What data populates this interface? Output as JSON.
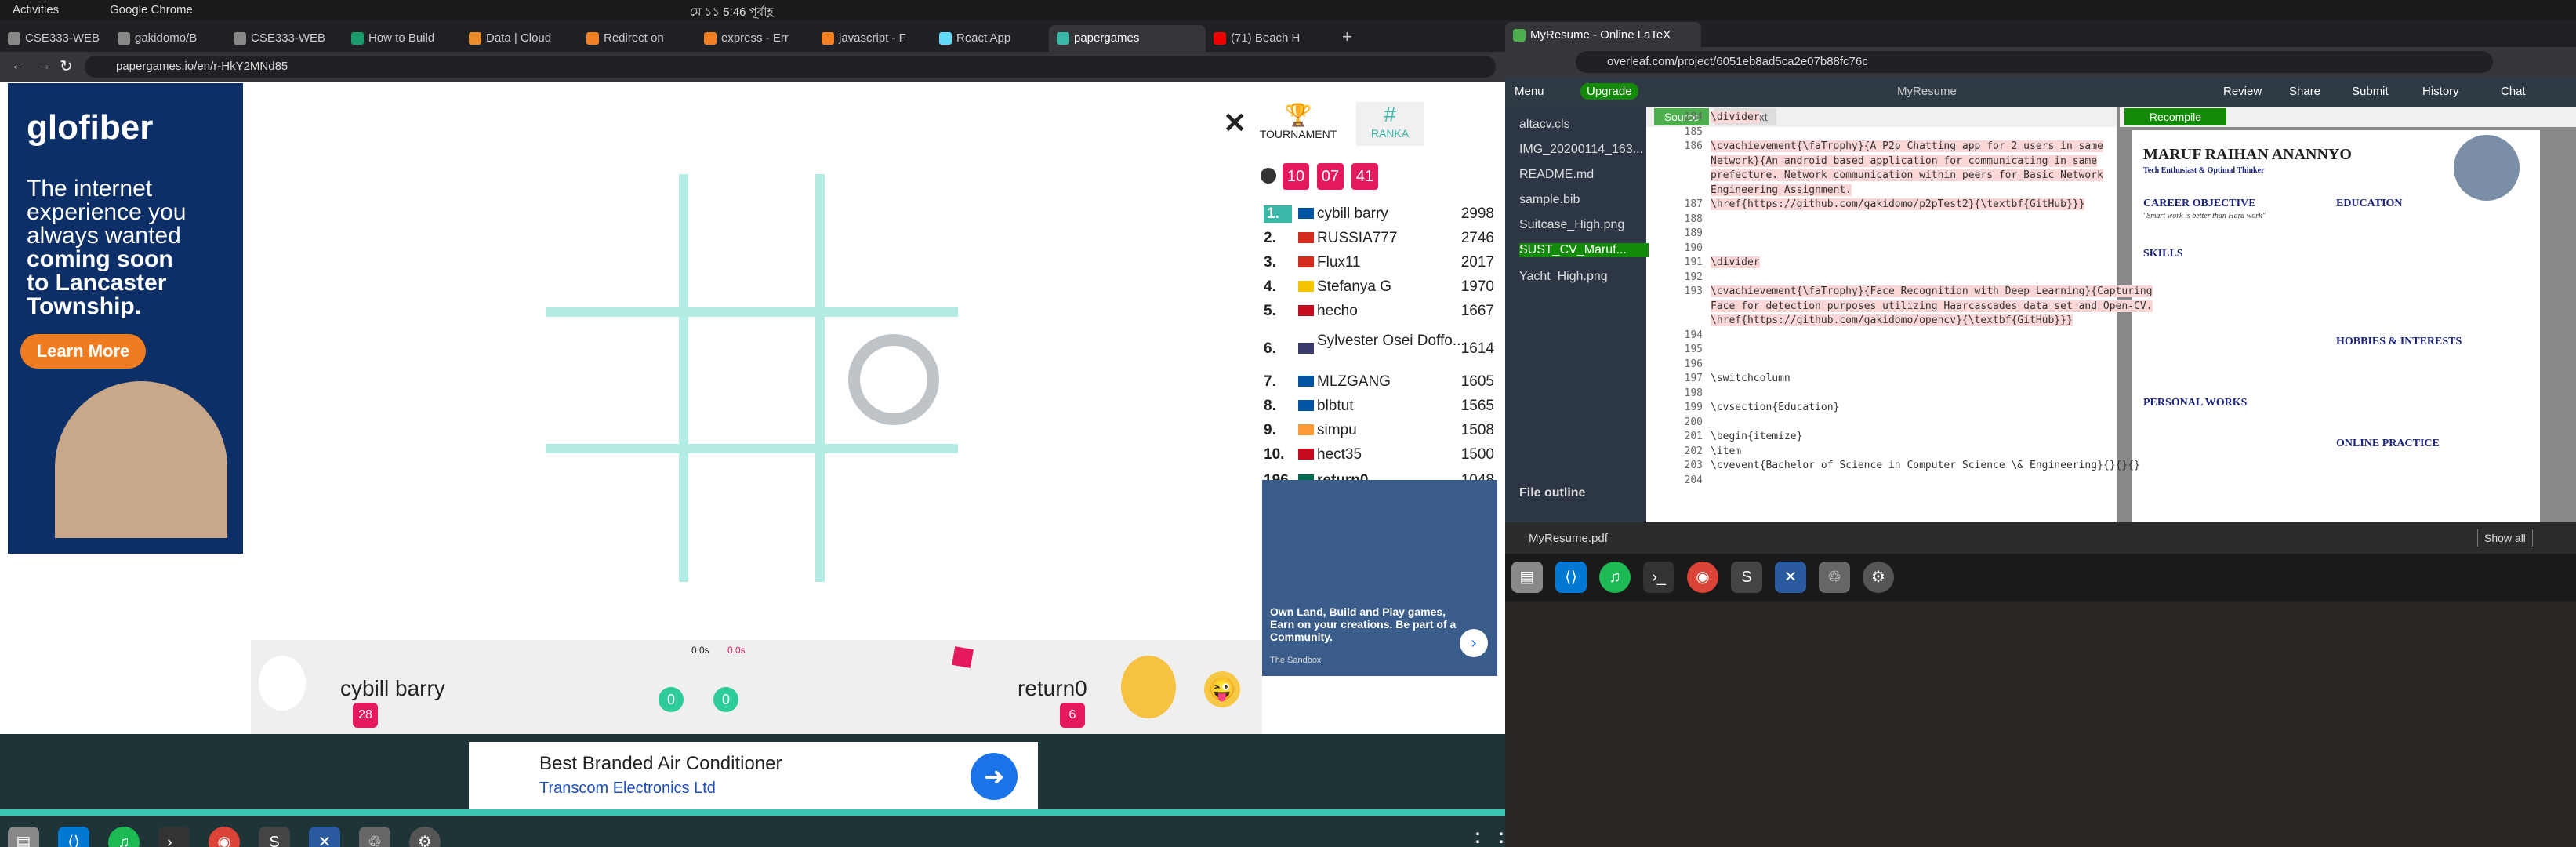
{
  "system": {
    "activities": "Activities",
    "app": "Google Chrome",
    "clock": "মে ১১  5:46 পূর্বাহ্ণ"
  },
  "left": {
    "tabs": [
      "CSE333-WEB",
      "gakidomo/B",
      "CSE333-WEB",
      "How to Build",
      "Data | Cloud",
      "Redirect on",
      "express - Err",
      "javascript - F",
      "React App",
      "papergames",
      "(71) Beach H"
    ],
    "url": "papergames.io/en/r-HkY2MNd85",
    "ad": {
      "brand": "glofiber",
      "line1": "The internet",
      "line2": "experience you",
      "line3": "always wanted",
      "line4": "coming soon",
      "line5": "to Lancaster",
      "line6": "Township.",
      "cta": "Learn More"
    },
    "close": "✕",
    "tournament": "TOURNAMENT",
    "ranka": "RANKA",
    "timer": [
      "10",
      "07",
      "41"
    ],
    "rankings": [
      {
        "pos": "1.",
        "name": "cybill barry",
        "score": "2998",
        "flag": "#0055a4"
      },
      {
        "pos": "2.",
        "name": "RUSSIA777",
        "score": "2746",
        "flag": "#d52b1e"
      },
      {
        "pos": "3.",
        "name": "Flux11",
        "score": "2017",
        "flag": "#d52b1e"
      },
      {
        "pos": "4.",
        "name": "Stefanya G",
        "score": "1970",
        "flag": "#f4c400"
      },
      {
        "pos": "5.",
        "name": "hecho",
        "score": "1667",
        "flag": "#c60b1e"
      },
      {
        "pos": "6.",
        "name": "Sylvester Osei Doffo...",
        "score": "1614",
        "flag": "#3c3b6e"
      },
      {
        "pos": "7.",
        "name": "MLZGANG",
        "score": "1605",
        "flag": "#0055a4"
      },
      {
        "pos": "8.",
        "name": "blbtut",
        "score": "1565",
        "flag": "#0055a4"
      },
      {
        "pos": "9.",
        "name": "simpu",
        "score": "1508",
        "flag": "#ff9933"
      },
      {
        "pos": "10.",
        "name": "hect35",
        "score": "1500",
        "flag": "#c60b1e"
      },
      {
        "pos": "196.",
        "name": "return0",
        "score": "1048",
        "flag": "#006a4e"
      }
    ],
    "game_ad": {
      "text": "Own Land, Build and Play games, Earn on your creations. Be part of a Community.",
      "src": "The Sandbox"
    },
    "player1": {
      "name": "cybill barry",
      "level": "28",
      "score": "0",
      "time": "0.0s"
    },
    "player2": {
      "name": "return0",
      "level": "6",
      "score": "0",
      "time": "0.0s"
    },
    "bottom_ad": {
      "title": "Best Branded Air Conditioner",
      "sub": "Transcom Electronics Ltd"
    }
  },
  "right": {
    "tab": "MyResume - Online LaTeX",
    "url": "overleaf.com/project/6051eb8ad5ca2e07b88fc76c",
    "menu": "Menu",
    "upgrade": "Upgrade",
    "project": "MyResume",
    "actions": [
      "Review",
      "Share",
      "Submit",
      "History",
      "Chat"
    ],
    "source": "Source",
    "rich": "Rich Text",
    "recompile": "Recompile",
    "files": [
      "altacv.cls",
      "IMG_20200114_163...",
      "README.md",
      "sample.bib",
      "Suitcase_High.png",
      "SUST_CV_Maruf...",
      "Yacht_High.png"
    ],
    "outline": "File outline",
    "lines": [
      "184",
      "185",
      "186",
      "",
      "",
      "",
      "187",
      "188",
      "189",
      "190",
      "191",
      "192",
      "193",
      "",
      "",
      "194",
      "195",
      "196",
      "197",
      "198",
      "199",
      "200",
      "201",
      "202",
      "203",
      "204"
    ],
    "code": [
      "\\divider",
      "",
      "\\cvachievement{\\faTrophy}{A P2p Chatting app for 2 users in same",
      "Network}{An android based application for communicating in same",
      "prefecture. Network communication within peers for Basic Network",
      "Engineering Assignment.",
      "\\href{https://github.com/gakidomo/p2pTest2}{\\textbf{GitHub}}}",
      "",
      "",
      "",
      "\\divider",
      "",
      "\\cvachievement{\\faTrophy}{Face Recognition with Deep Learning}{Capturing",
      "Face for detection purposes utilizing Haarcascades data set and Open-CV.",
      "\\href{https://github.com/gakidomo/opencv}{\\textbf{GitHub}}}",
      "",
      "",
      "",
      "\\switchcolumn",
      "",
      "\\cvsection{Education}",
      "",
      "\\begin{itemize}",
      "\\item",
      "\\cvevent{Bachelor of Science in Computer Science \\& Engineering}{}{}{}",
      ""
    ],
    "pdf": {
      "name": "MARUF RAIHAN ANANNYO",
      "role": "Tech Enthusiast & Optimal Thinker",
      "sections_l": [
        "CAREER OBJECTIVE",
        "SKILLS",
        "PERSONAL WORKS"
      ],
      "sections_r": [
        "EDUCATION",
        "HOBBIES & INTERESTS",
        "ONLINE PRACTICE"
      ],
      "quote": "\"Smart work is better than Hard work\""
    },
    "download": {
      "file": "MyResume.pdf",
      "showall": "Show all"
    }
  }
}
